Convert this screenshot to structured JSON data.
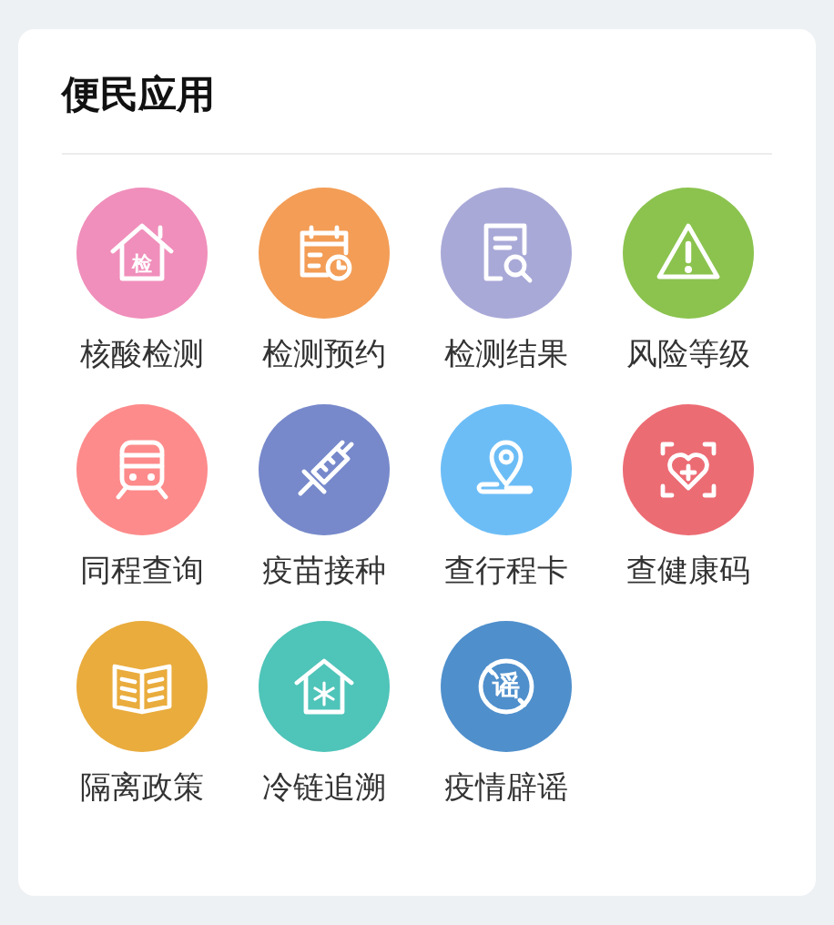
{
  "section": {
    "title": "便民应用"
  },
  "apps": [
    {
      "label": "核酸检测",
      "kind": "house-badge",
      "color": "#f08fbb",
      "glyph": "检"
    },
    {
      "label": "检测预约",
      "kind": "calendar-clock",
      "color": "#f39d56"
    },
    {
      "label": "检测结果",
      "kind": "document-search",
      "color": "#a9a9d8"
    },
    {
      "label": "风险等级",
      "kind": "warning",
      "color": "#8bc34e"
    },
    {
      "label": "同程查询",
      "kind": "train",
      "color": "#fd8b8b"
    },
    {
      "label": "疫苗接种",
      "kind": "syringe",
      "color": "#7789cb"
    },
    {
      "label": "查行程卡",
      "kind": "location-pin",
      "color": "#6cbdf6"
    },
    {
      "label": "查健康码",
      "kind": "heart-scan",
      "color": "#ec6c74"
    },
    {
      "label": "隔离政策",
      "kind": "book",
      "color": "#e9ac3d"
    },
    {
      "label": "冷链追溯",
      "kind": "house-snowflake",
      "color": "#4fc4b9"
    },
    {
      "label": "疫情辟谣",
      "kind": "no-rumor",
      "color": "#4f8fcc",
      "glyph": "谣"
    }
  ]
}
